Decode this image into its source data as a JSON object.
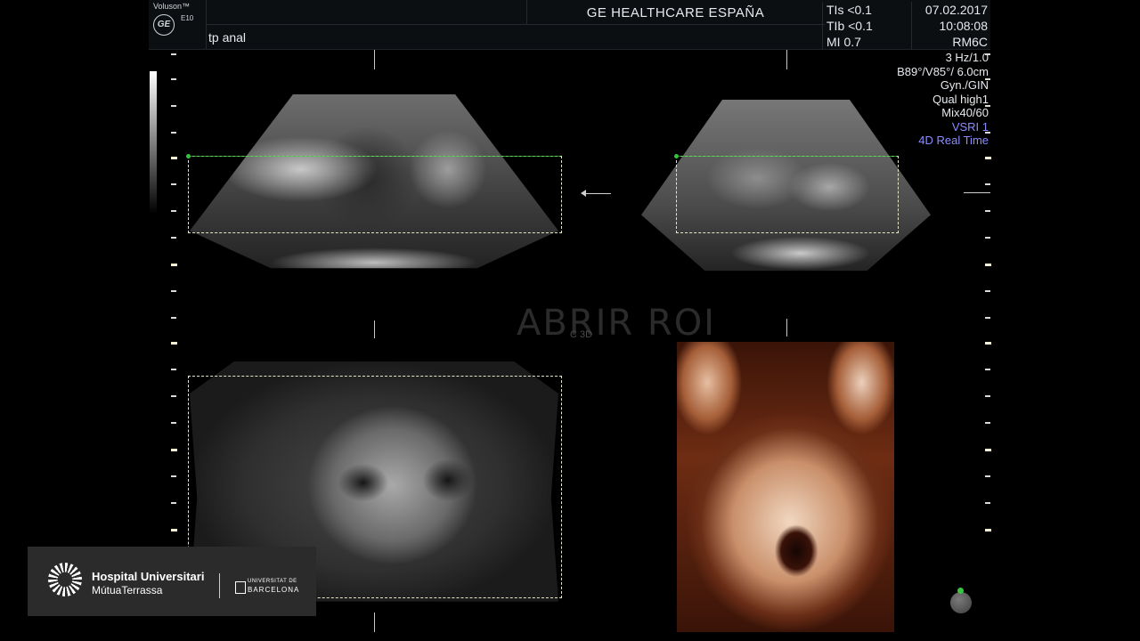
{
  "header": {
    "brand_name": "Voluson™",
    "model": "E10",
    "logo_text": "GE",
    "title": "GE HEALTHCARE ESPAÑA",
    "probe_label": "tp anal",
    "ti": [
      "TIs <0.1",
      "TIb <0.1",
      "MI  0.7"
    ],
    "date": "07.02.2017",
    "time": "10:08:08",
    "probe": "RM6C"
  },
  "params": {
    "lines": [
      "3 Hz/1.0",
      "B89°/V85°/ 6.0cm",
      "Gyn./GIN",
      "Qual high1",
      "Mix40/60"
    ],
    "vsri": "VSRI 1",
    "mode": "4D Real Time"
  },
  "overlay": {
    "watermark": "ABRIR ROI",
    "cplane_tag": "C 3D"
  },
  "badge": {
    "hospital_line1": "Hospital Universitari",
    "hospital_line2": "MútuaTerrassa",
    "university_line1": "UNIVERSITAT DE",
    "university_line2": "BARCELONA"
  },
  "colors": {
    "accent_blue": "#8b8cff",
    "roi_green": "#34c43a",
    "render_tone": "#c98f6a"
  }
}
